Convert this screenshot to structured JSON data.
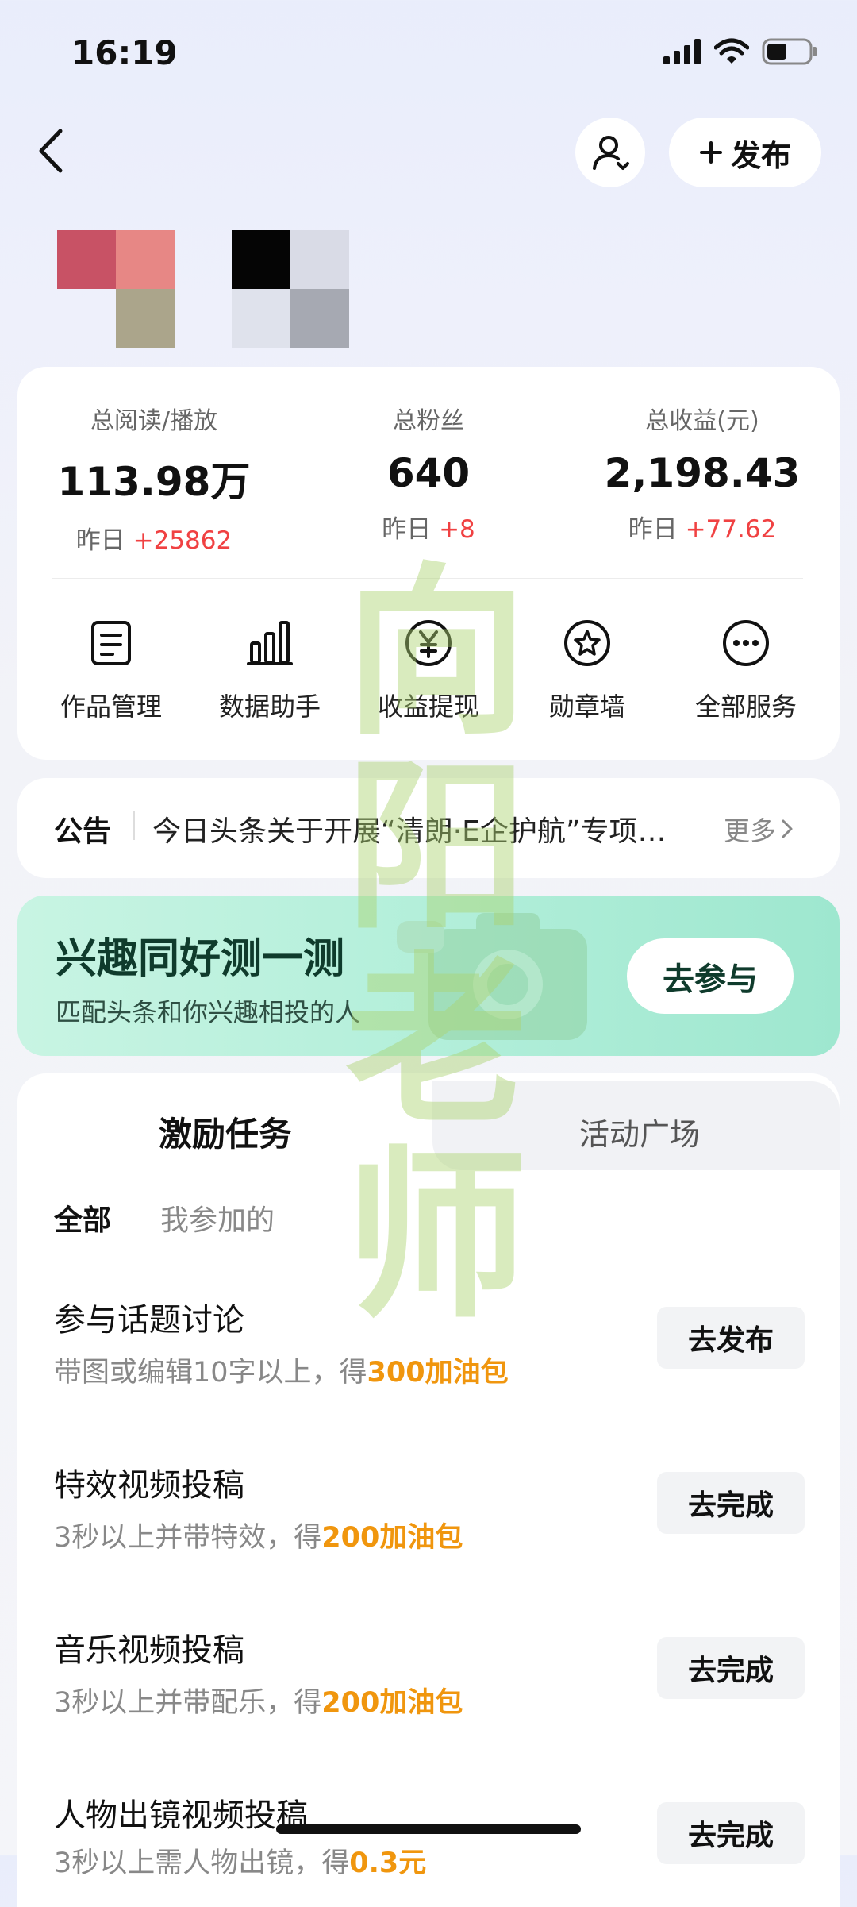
{
  "status_bar": {
    "time": "16:19"
  },
  "header": {
    "publish_label": "发布"
  },
  "stats": [
    {
      "label": "总阅读/播放",
      "value": "113.98万",
      "sub_prefix": "昨日",
      "sub_value": "+25862"
    },
    {
      "label": "总粉丝",
      "value": "640",
      "sub_prefix": "昨日",
      "sub_value": "+8"
    },
    {
      "label": "总收益(元)",
      "value": "2,198.43",
      "sub_prefix": "昨日",
      "sub_value": "+77.62"
    }
  ],
  "services": [
    {
      "label": "作品管理",
      "icon": "document-icon"
    },
    {
      "label": "数据助手",
      "icon": "bar-chart-icon"
    },
    {
      "label": "收益提现",
      "icon": "yuan-coin-icon"
    },
    {
      "label": "勋章墙",
      "icon": "medal-icon"
    },
    {
      "label": "全部服务",
      "icon": "more-dots-icon"
    }
  ],
  "notice": {
    "title": "公告",
    "text": "今日头条关于开展“清朗·E企护航”专项行动的公告",
    "more": "更多"
  },
  "banner": {
    "title": "兴趣同好测一测",
    "subtitle": "匹配头条和你兴趣相投的人",
    "button": "去参与"
  },
  "tasks": {
    "tabs": [
      "激励任务",
      "活动广场"
    ],
    "filters": [
      "全部",
      "我参加的"
    ],
    "items": [
      {
        "title": "参与话题讨论",
        "desc": "带图或编辑10字以上，得",
        "reward": "300加油包",
        "button": "去发布"
      },
      {
        "title": "特效视频投稿",
        "desc": "3秒以上并带特效，得",
        "reward": "200加油包",
        "button": "去完成"
      },
      {
        "title": "音乐视频投稿",
        "desc": "3秒以上并带配乐，得",
        "reward": "200加油包",
        "button": "去完成"
      },
      {
        "title": "人物出镜视频投稿",
        "desc": "3秒以上需人物出镜，得",
        "reward": "0.3元",
        "button": "去完成"
      }
    ]
  },
  "watermark": {
    "text": "向阳老师"
  }
}
